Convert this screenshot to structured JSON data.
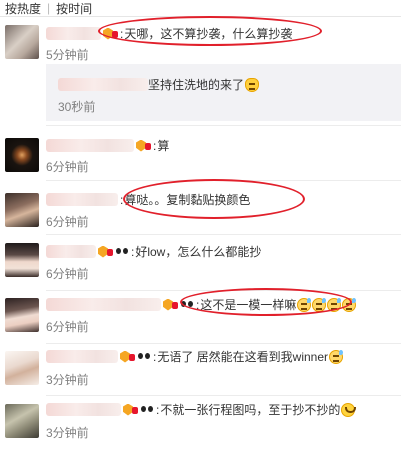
{
  "sort": {
    "hot": "按热度",
    "separator": "|",
    "time": "按时间"
  },
  "colors": {
    "annotation": "#e1202b",
    "time_text": "#808080",
    "reply_bg": "#f2f2f5"
  },
  "comments": [
    {
      "text": "天哪，这不算抄袭，什么算抄袭",
      "time": "5分钟前",
      "reply": {
        "text": "坚持住洗地的来了",
        "time": "30秒前"
      }
    },
    {
      "text": "算",
      "time": "6分钟前"
    },
    {
      "text": "算哒。。复制黏贴换颜色",
      "time": "6分钟前"
    },
    {
      "text": "好low，怎么什么都能抄",
      "time": "6分钟前"
    },
    {
      "text": "这不是一模一样嘛",
      "time": "6分钟前"
    },
    {
      "text": "无语了 居然能在这看到我winner",
      "time": "3分钟前"
    },
    {
      "text": "不就一张行程图吗，至于抄不抄的",
      "time": "3分钟前"
    }
  ]
}
